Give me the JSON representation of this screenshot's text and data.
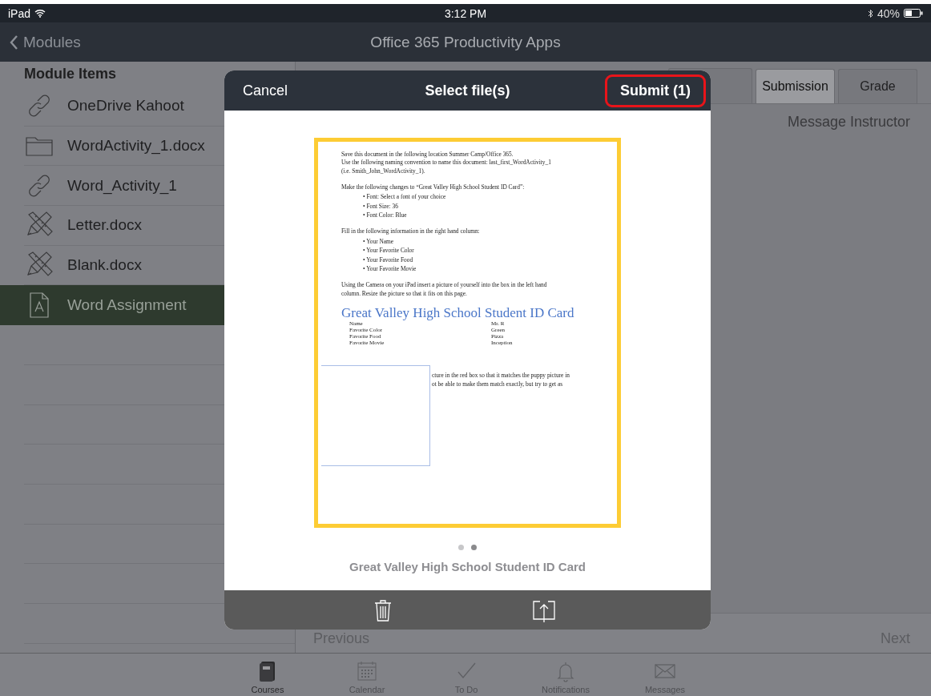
{
  "status_bar": {
    "carrier": "iPad",
    "time": "3:12 PM",
    "battery": "40%"
  },
  "nav": {
    "back": "Modules",
    "title": "Office 365 Productivity Apps"
  },
  "sidebar": {
    "title": "Module Items",
    "items": [
      {
        "label": "OneDrive Kahoot",
        "kind": "link",
        "selected": false
      },
      {
        "label": "WordActivity_1.docx",
        "kind": "folder",
        "selected": false
      },
      {
        "label": "Word_Activity_1",
        "kind": "link",
        "selected": false
      },
      {
        "label": "Letter.docx",
        "kind": "tools",
        "selected": false
      },
      {
        "label": "Blank.docx",
        "kind": "tools",
        "selected": false
      },
      {
        "label": "Word Assignment",
        "kind": "document",
        "selected": true
      }
    ]
  },
  "content": {
    "tabs": [
      {
        "label": "Submission",
        "selected": true
      },
      {
        "label": "Grade",
        "selected": false
      }
    ],
    "message_button": "Message Instructor",
    "previous": "Previous",
    "next": "Next"
  },
  "modal": {
    "cancel": "Cancel",
    "title": "Select file(s)",
    "submit": "Submit (1)",
    "submit_highlighted": true,
    "document": {
      "blocks": [
        {
          "kind": "para",
          "lines": [
            "Save this document in the following location Summer Camp/Office 365.",
            "Use the following naming convention to name this document: last_first_WordActivity_1",
            "(i.e. Smith_John_WordActivity_1)."
          ]
        },
        {
          "kind": "para",
          "lines": [
            "Make the following changes to “Great Valley High School Student ID Card”:"
          ]
        },
        {
          "kind": "bullets",
          "items": [
            "• Font: Select a font of your choice",
            "• Font Size: 36",
            "• Font Color: Blue"
          ]
        },
        {
          "kind": "para",
          "lines": [
            "Fill in the following information in the right hand column:"
          ]
        },
        {
          "kind": "bullets",
          "items": [
            "• Your Name",
            "• Your Favorite Color",
            "• Your Favorite Food",
            "• Your Favorite Movie"
          ]
        },
        {
          "kind": "para",
          "lines": [
            "Using the Camera on your iPad insert a picture of yourself into the box in the left hand",
            "column.  Resize the picture so that it fits on this page."
          ]
        },
        {
          "kind": "heading",
          "text": "Great Valley High School Student ID Card"
        },
        {
          "kind": "table",
          "rows": [
            [
              "Name",
              "Mr. R"
            ],
            [
              "Favorite Color",
              "Green"
            ],
            [
              "Favorite Food",
              "Pizza"
            ],
            [
              "Favorite Movie",
              "Inception"
            ]
          ]
        },
        {
          "kind": "boxed",
          "lines": [
            "cture in the red box so that it matches the puppy picture in",
            "ot be able to make them match exactly, but try to get as"
          ]
        }
      ]
    },
    "page_dots": [
      {
        "selected": false
      },
      {
        "selected": true
      }
    ],
    "caption": "Great Valley High School Student ID Card"
  },
  "tab_bar": [
    {
      "label": "Courses",
      "kind": "courses",
      "selected": true
    },
    {
      "label": "Calendar",
      "kind": "calendar",
      "selected": false
    },
    {
      "label": "To Do",
      "kind": "todo",
      "selected": false
    },
    {
      "label": "Notifications",
      "kind": "bell",
      "selected": false
    },
    {
      "label": "Messages",
      "kind": "mail",
      "selected": false
    }
  ]
}
